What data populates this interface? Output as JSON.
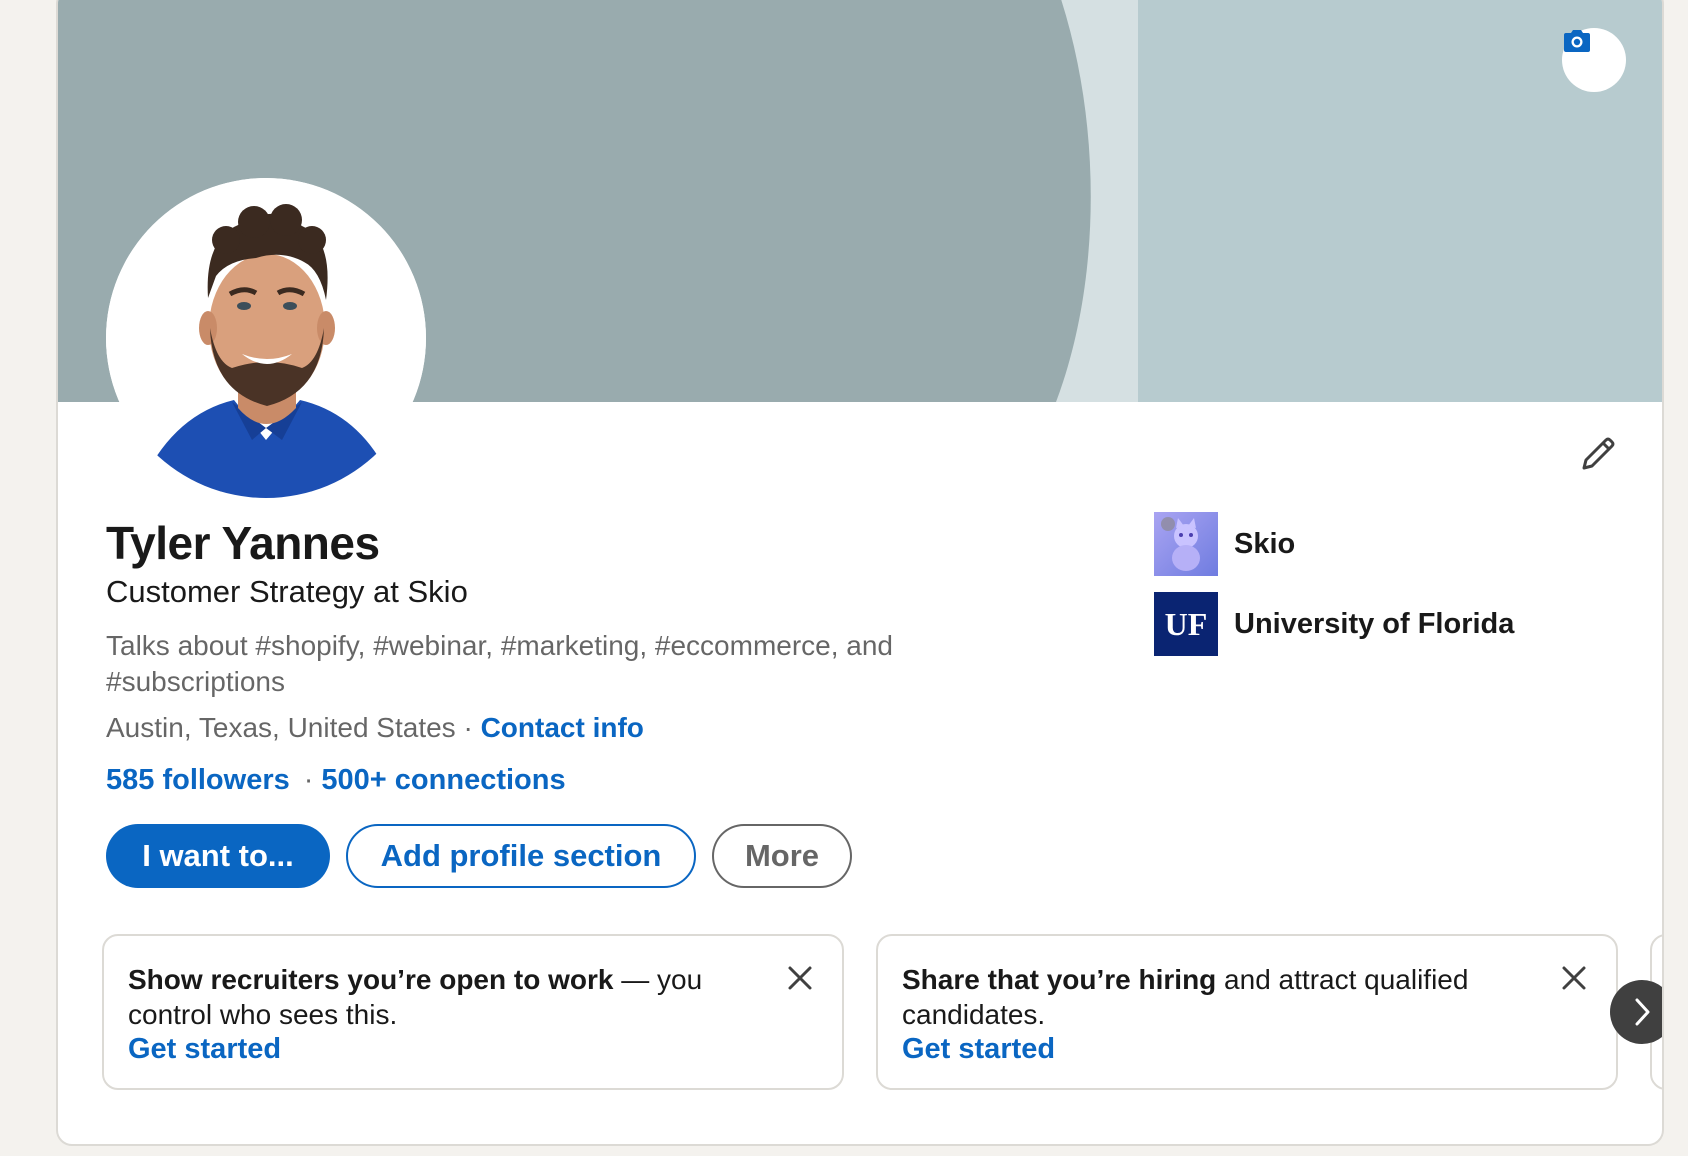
{
  "profile": {
    "name": "Tyler Yannes",
    "headline": "Customer Strategy at Skio",
    "topics": "Talks about #shopify, #webinar, #marketing, #eccommerce, and #subscriptions",
    "location": "Austin, Texas, United States",
    "location_separator": " · ",
    "contact_info_label": "Contact info",
    "followers_label": "585 followers",
    "network_separator": "·",
    "connections_label": "500+ connections"
  },
  "actions": {
    "primary_label": "I want to...",
    "secondary_label": "Add profile section",
    "more_label": "More"
  },
  "organizations": [
    {
      "name": "Skio",
      "logo": "skio-logo"
    },
    {
      "name": "University of Florida",
      "logo": "uf-logo",
      "logo_text": "UF"
    }
  ],
  "promos": [
    {
      "bold": "Show recruiters you’re open to work",
      "rest": " — you control who sees this.",
      "link": "Get started"
    },
    {
      "bold": "Share that you’re hiring",
      "rest": " and attract qualified candidates.",
      "link": "Get started"
    }
  ],
  "icons": {
    "camera": "camera-icon",
    "edit": "pencil-icon",
    "dismiss": "close-icon",
    "next": "chevron-right-icon"
  },
  "colors": {
    "accent": "#0a66c2",
    "banner_dark": "#99abae",
    "banner_light": "#b7cbcf",
    "banner_band": "#d5e0e2",
    "uf_blue": "#0a2472",
    "page_bg": "#f4f2ee"
  }
}
